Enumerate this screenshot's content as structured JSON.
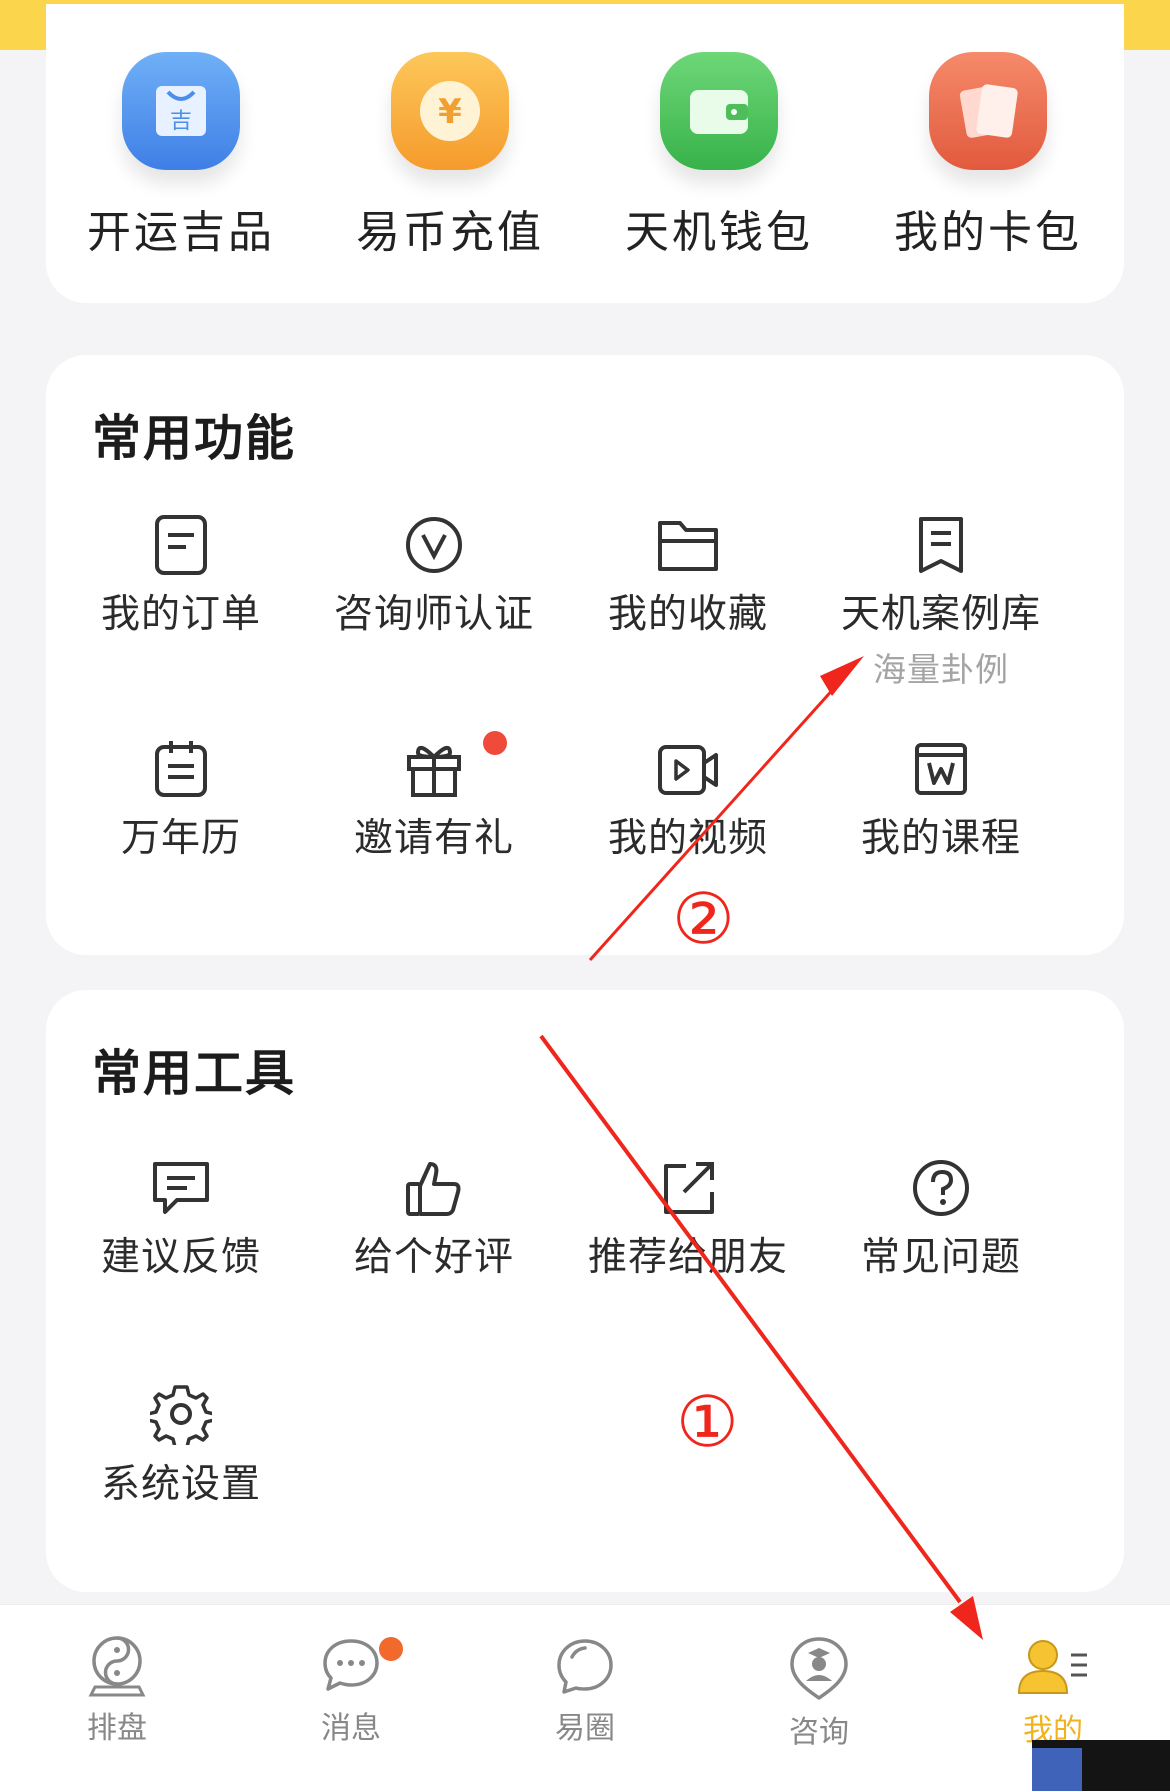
{
  "quick_actions": [
    {
      "label": "开运吉品",
      "icon": "shopping-bag-icon",
      "color": "#4a8fec"
    },
    {
      "label": "易币充值",
      "icon": "yen-coin-icon",
      "color": "#f7a93a"
    },
    {
      "label": "天机钱包",
      "icon": "wallet-icon",
      "color": "#4ebe5a"
    },
    {
      "label": "我的卡包",
      "icon": "card-pack-icon",
      "color": "#ea6a4c"
    }
  ],
  "common_functions": {
    "title": "常用功能",
    "items": [
      {
        "label": "我的订单",
        "icon": "order-icon"
      },
      {
        "label": "咨询师认证",
        "icon": "verified-icon"
      },
      {
        "label": "我的收藏",
        "icon": "folder-icon"
      },
      {
        "label": "天机案例库",
        "sub": "海量卦例",
        "icon": "bookmark-icon"
      },
      {
        "label": "万年历",
        "icon": "calendar-icon"
      },
      {
        "label": "邀请有礼",
        "icon": "gift-icon",
        "badge": true
      },
      {
        "label": "我的视频",
        "icon": "video-icon"
      },
      {
        "label": "我的课程",
        "icon": "course-icon"
      }
    ]
  },
  "common_tools": {
    "title": "常用工具",
    "items": [
      {
        "label": "建议反馈",
        "icon": "feedback-icon"
      },
      {
        "label": "给个好评",
        "icon": "thumbs-up-icon"
      },
      {
        "label": "推荐给朋友",
        "icon": "share-icon"
      },
      {
        "label": "常见问题",
        "icon": "question-icon"
      },
      {
        "label": "系统设置",
        "icon": "gear-icon"
      }
    ]
  },
  "tabbar": {
    "items": [
      {
        "label": "排盘",
        "icon": "yin-yang-icon"
      },
      {
        "label": "消息",
        "icon": "chat-bubble-icon",
        "badge": true
      },
      {
        "label": "易圈",
        "icon": "circle-bubble-icon"
      },
      {
        "label": "咨询",
        "icon": "consultant-icon"
      },
      {
        "label": "我的",
        "icon": "profile-icon",
        "active": true
      }
    ],
    "active_color": "#f0b31d"
  },
  "annotations": {
    "marker_1": "①",
    "marker_2": "②",
    "arrow_color": "#f0261c"
  }
}
